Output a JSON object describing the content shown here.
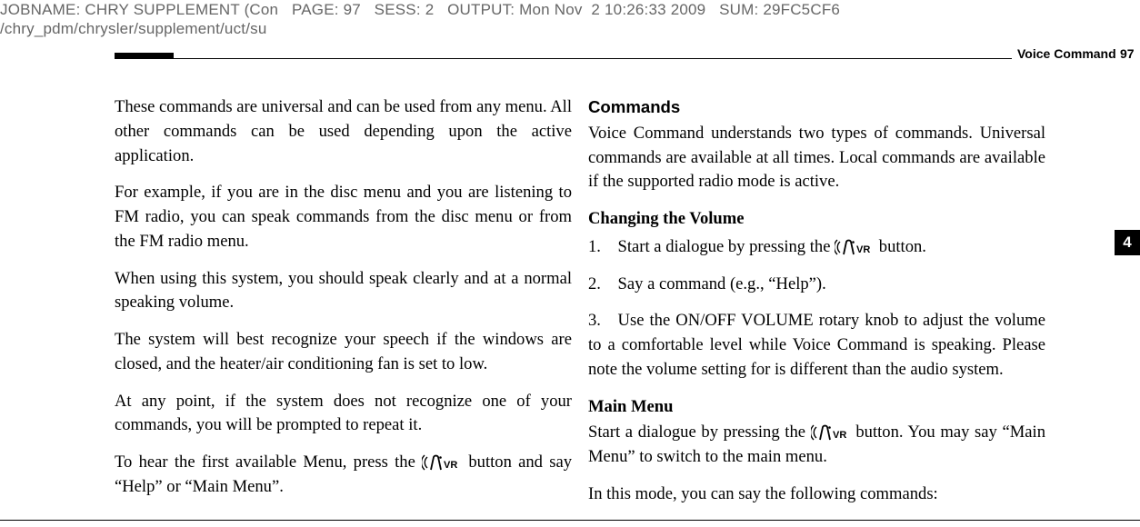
{
  "debug": {
    "line1": "JOBNAME: CHRY SUPPLEMENT (Con   PAGE: 97   SESS: 2   OUTPUT: Mon Nov  2 10:26:33 2009   SUM: 29FC5CF6",
    "line2": "/chry_pdm/chrysler/supplement/uct/su"
  },
  "header": {
    "running_title": "Voice Command",
    "page_number": "97"
  },
  "tab": {
    "number": "4"
  },
  "left": {
    "p1": "These commands are universal and can be used from any menu. All other commands can be used depending upon the active application.",
    "p2": "For example, if you are in the disc menu and you are listening to FM radio, you can speak commands from the disc menu or from the FM radio menu.",
    "p3": "When using this system, you should speak clearly and at a normal speaking volume.",
    "p4": "The system will best recognize your speech if the windows are closed, and the heater/air conditioning fan is set to low.",
    "p5": "At any point, if the system does not recognize one of your commands, you will be prompted to repeat it.",
    "p6a": "To hear the first available Menu, press the ",
    "p6b": " button and say “Help” or “Main Menu”."
  },
  "right": {
    "h1": "Commands",
    "r1": "Voice Command understands two types of commands. Universal commands are available at all times. Local commands are available if the supported radio mode is active.",
    "h2": "Changing the Volume",
    "s1a": "1. Start a dialogue by pressing the ",
    "s1b": " button.",
    "s2": "2. Say a command (e.g., “Help”).",
    "s3": "3. Use the ON/OFF VOLUME rotary knob to adjust the volume to a comfortable level while Voice Command is speaking. Please note the volume setting for is different than the audio system.",
    "h3": "Main Menu",
    "m1a": "Start a dialogue by pressing the ",
    "m1b": " button. You may say “Main Menu” to switch to the main menu.",
    "m2": "In this mode, you can say the following commands:"
  }
}
